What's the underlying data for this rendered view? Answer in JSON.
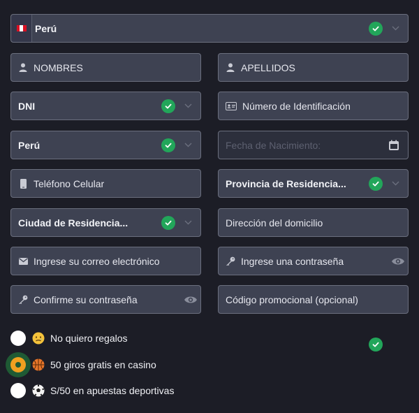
{
  "country": {
    "label": "Perú",
    "flag_colors": [
      "#d91023",
      "#ffffff",
      "#d91023"
    ]
  },
  "fields": {
    "nombres": {
      "placeholder": "NOMBRES"
    },
    "apellidos": {
      "placeholder": "APELLIDOS"
    },
    "doc_type": {
      "value": "DNI"
    },
    "doc_number": {
      "placeholder": "Número de Identificación"
    },
    "nationality": {
      "value": "Perú"
    },
    "birthdate": {
      "placeholder": "Fecha de Nacimiento:"
    },
    "phone": {
      "placeholder": "Teléfono Celular"
    },
    "province": {
      "value": "Provincia de Residencia..."
    },
    "city": {
      "value": "Ciudad de Residencia..."
    },
    "address": {
      "placeholder": "Dirección del domicilio"
    },
    "email": {
      "placeholder": "Ingrese su correo electrónico"
    },
    "password": {
      "placeholder": "Ingrese una contraseña"
    },
    "password_confirm": {
      "placeholder": "Confirme su contraseña"
    },
    "promo": {
      "placeholder": "Código promocional (opcional)"
    }
  },
  "bonus_options": [
    {
      "label": "No quiero regalos",
      "icon": "sad-face-emoji",
      "selected": false
    },
    {
      "label": "50 giros gratis en casino",
      "icon": "basketball-emoji",
      "selected": true
    },
    {
      "label": "S/50 en apuestas deportivas",
      "icon": "soccer-ball-emoji",
      "selected": false
    }
  ],
  "colors": {
    "background": "#1c1d26",
    "field_bg": "#3e4252",
    "field_border": "#6b6f7e",
    "check_green": "#22a65a",
    "radio_selected": "#f0a020",
    "radio_ring": "#1f5a34"
  }
}
